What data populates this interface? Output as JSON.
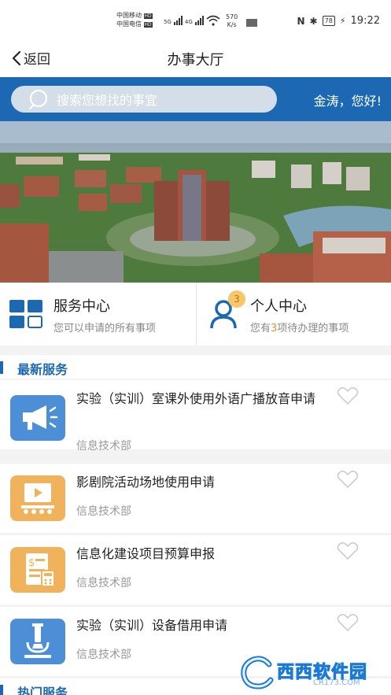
{
  "status_bar": {
    "carrier1": "中国移动",
    "carrier2": "中国电信",
    "hd": "HD",
    "net1": "5G",
    "net2": "4G",
    "speed_value": "570",
    "speed_unit": "K/s",
    "battery": "78",
    "time": "19:22"
  },
  "nav": {
    "back_label": "返回",
    "title": "办事大厅"
  },
  "search": {
    "placeholder": "搜索您想找的事宜"
  },
  "greeting": "金涛，您好!",
  "quick_cards": [
    {
      "title": "服务中心",
      "subtitle": "您可以申请的所有事项"
    },
    {
      "title": "个人中心",
      "badge": "3",
      "subtitle_pre": "您有",
      "subtitle_count": "3",
      "subtitle_post": "项待办理的事项"
    }
  ],
  "sections": {
    "latest": "最新服务",
    "hot": "热门服务"
  },
  "services": [
    {
      "title": "实验（实训）室课外使用外语广播放音申请",
      "dept": "信息技术部",
      "icon": "megaphone-icon"
    },
    {
      "title": "影剧院活动场地使用申请",
      "dept": "信息技术部",
      "icon": "theater-icon"
    },
    {
      "title": "信息化建设项目预算申报",
      "dept": "信息技术部",
      "icon": "budget-icon"
    },
    {
      "title": "实验（实训）设备借用申请",
      "dept": "信息技术部",
      "icon": "microscope-icon"
    }
  ],
  "watermark": {
    "text": "西西软件园",
    "url": "CR173.COM"
  },
  "colors": {
    "primary": "#1c68b2",
    "icon_blue": "#4c8fd6",
    "icon_orange": "#f0b25a",
    "accent_orange": "#e0922c"
  }
}
